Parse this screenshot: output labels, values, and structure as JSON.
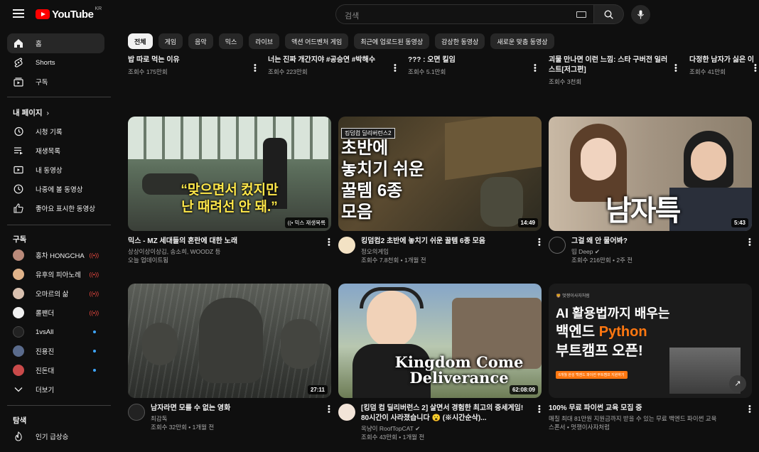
{
  "header": {
    "logo_text": "YouTube",
    "region": "KR",
    "search_placeholder": "검색"
  },
  "sidebar": {
    "main": [
      {
        "label": "홈",
        "icon": "home-icon"
      },
      {
        "label": "Shorts",
        "icon": "shorts-icon"
      },
      {
        "label": "구독",
        "icon": "subscriptions-icon"
      }
    ],
    "you_title": "내 페이지",
    "you_items": [
      {
        "label": "시청 기록",
        "icon": "history-icon"
      },
      {
        "label": "재생목록",
        "icon": "playlists-icon"
      },
      {
        "label": "내 동영상",
        "icon": "your-videos-icon"
      },
      {
        "label": "나중에 볼 동영상",
        "icon": "watch-later-icon"
      },
      {
        "label": "좋아요 표시한 동영상",
        "icon": "liked-icon"
      }
    ],
    "subs_title": "구독",
    "subs": [
      {
        "label": "홍차 HONGCHA",
        "status": "live",
        "color": "#b98a7a"
      },
      {
        "label": "유후의 피아노레",
        "status": "live",
        "color": "#e0b38a"
      },
      {
        "label": "오마르의 삶",
        "status": "live",
        "color": "#d9c1b0"
      },
      {
        "label": "롤팬더",
        "status": "live",
        "color": "#f0f0f0"
      },
      {
        "label": "1vsAll",
        "status": "new",
        "color": "#222222"
      },
      {
        "label": "진용진",
        "status": "new",
        "color": "#5a6b8c"
      },
      {
        "label": "진돈대",
        "status": "new",
        "color": "#c94a4a"
      }
    ],
    "more_label": "더보기",
    "explore_title": "탐색",
    "explore_items": [
      {
        "label": "인기 급상승",
        "icon": "trending-icon"
      }
    ]
  },
  "chips": [
    "전체",
    "게임",
    "음악",
    "믹스",
    "라이브",
    "액션 어드벤처 게임",
    "최근에 업로드된 동영상",
    "감상한 동영상",
    "새로운 맞춤 동영상"
  ],
  "prev_row": [
    {
      "title": "밥 따로 먹는 이유",
      "meta": "조회수 175만회"
    },
    {
      "title": "너는 진짜 개간지야 #공승연 #박해수",
      "meta": "조회수 223만회"
    },
    {
      "title": "??? : 오면 킬임",
      "meta": "조회수 5.1만회"
    },
    {
      "title": "괴물 만나면 이런 느낌: 스타 구버전 일러스트[저그편]",
      "meta": "조회수 3천회"
    },
    {
      "title": "다정한 남자가 싫은 이",
      "meta": "조회수 41만회"
    }
  ],
  "videos": [
    {
      "title": "믹스 - MZ 세대들의 혼란에 대한 노래",
      "line1": "상상이상이상김, 송소희, WOODZ 등",
      "line2": "오늘 업데이트됨",
      "overlay": "“맞으면서 컸지만\n난 때려선 안 돼.”",
      "badge": "믹스 재생목록",
      "duration": ""
    },
    {
      "title": "킹덤컴2 초반에 놓치기 쉬운 꿀템 6종 모음",
      "line1": "정오의게임",
      "line2": "조회수 7.8천회 • 1개월 전",
      "tag": "킹덤컴 딜리버런스2",
      "overlay": "초반에\n놓치기 쉬운\n꿀템 6종\n모음",
      "duration": "14:49"
    },
    {
      "title": "그걸 왜 안 물어봐?",
      "line1": "띱 Deep",
      "line2": "조회수 216만회 • 2주 전",
      "overlay": "남자특",
      "duration": "5:43"
    },
    {
      "title": "남자라면 모를 수 없는 영화",
      "line1": "최감독",
      "line2": "조회수 32만회 • 1개월 전",
      "duration": "27:11"
    },
    {
      "title": "[킹덤 컴 딜리버런스 2] 살면서 경험한 최고의 중세게임! 80시간이 사라졌습니다 😮 (※시간순삭)...",
      "line1": "옥냥이 RoofTopCAT",
      "line2": "조회수 43만회 • 1개월 전",
      "overlay": "Kingdom Come\nDeliverance",
      "duration": "62:08:09"
    },
    {
      "title": "100% 무료 파이썬 교육 모집 중",
      "line1": "매칠 최대 81만원 지원금까지 받을 수 있는 무료 백엔드 파이썬 교육",
      "line2": "스폰서 • 멋쟁이사자처럼",
      "brand": "멋쟁이사자처럼",
      "overlay1": "AI 활용법까지 배우는",
      "overlay2": "백엔드 ",
      "overlay2b": "Python",
      "overlay3": "부트캠프 오픈!",
      "banner": "6개월 완성 백엔드 파이썬 부트캠프 지원하기",
      "duration": ""
    }
  ],
  "colors": {
    "accent": "#ff0000",
    "python": "#ff7710",
    "live": "#ff4e45",
    "new_dot": "#3ea6ff"
  }
}
